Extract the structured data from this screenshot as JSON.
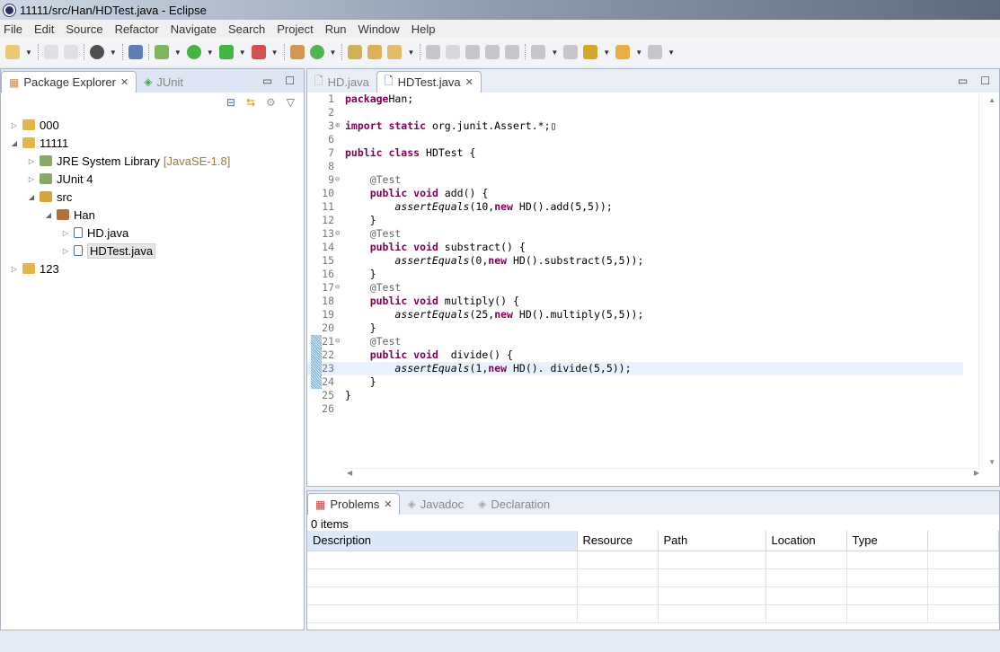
{
  "window": {
    "title": "11111/src/Han/HDTest.java - Eclipse"
  },
  "menu": [
    "File",
    "Edit",
    "Source",
    "Refactor",
    "Navigate",
    "Search",
    "Project",
    "Run",
    "Window",
    "Help"
  ],
  "left_panel": {
    "tabs": [
      {
        "label": "Package Explorer",
        "active": true
      },
      {
        "label": "JUnit",
        "active": false
      }
    ],
    "tree": [
      {
        "label": "000",
        "depth": 0,
        "twisty": "closed",
        "icon": "project-icon"
      },
      {
        "label": "11111",
        "depth": 0,
        "twisty": "open",
        "icon": "project-icon"
      },
      {
        "label": "JRE System Library",
        "decoration": "[JavaSE-1.8]",
        "depth": 1,
        "twisty": "closed",
        "icon": "library-icon"
      },
      {
        "label": "JUnit 4",
        "depth": 1,
        "twisty": "closed",
        "icon": "library-icon"
      },
      {
        "label": "src",
        "depth": 1,
        "twisty": "open",
        "icon": "source-folder-icon"
      },
      {
        "label": "Han",
        "depth": 2,
        "twisty": "open",
        "icon": "package-icon"
      },
      {
        "label": "HD.java",
        "depth": 3,
        "twisty": "closed",
        "icon": "java-file-icon"
      },
      {
        "label": "HDTest.java",
        "depth": 3,
        "twisty": "closed",
        "icon": "java-file-icon",
        "selected": true
      },
      {
        "label": "123",
        "depth": 0,
        "twisty": "closed",
        "icon": "project-icon"
      }
    ]
  },
  "editor": {
    "tabs": [
      {
        "label": "HD.java",
        "active": false
      },
      {
        "label": "HDTest.java",
        "active": true
      }
    ],
    "current_line": "23",
    "changed_lines": [
      "21",
      "22",
      "23",
      "24"
    ],
    "lines": [
      {
        "n": "1",
        "s": [
          [
            "kw",
            "package"
          ],
          [
            "",
            "Han;"
          ]
        ]
      },
      {
        "n": "2",
        "s": []
      },
      {
        "n": "3",
        "fold": "plus",
        "s": [
          [
            "kw",
            "import static"
          ],
          [
            "",
            " org.junit.Assert.*;"
          ],
          [
            "",
            "▯"
          ]
        ]
      },
      {
        "n": "6",
        "s": []
      },
      {
        "n": "7",
        "s": [
          [
            "kw",
            "public class"
          ],
          [
            "",
            " HDTest {"
          ]
        ]
      },
      {
        "n": "8",
        "s": []
      },
      {
        "n": "9",
        "fold": "minus",
        "s": [
          [
            "",
            "    "
          ],
          [
            "an",
            "@Test"
          ]
        ]
      },
      {
        "n": "10",
        "s": [
          [
            "",
            "    "
          ],
          [
            "kw",
            "public void"
          ],
          [
            "",
            " add() {"
          ]
        ]
      },
      {
        "n": "11",
        "s": [
          [
            "",
            "        "
          ],
          [
            "it",
            "assertEquals"
          ],
          [
            "",
            "(10,"
          ],
          [
            "kw",
            "new"
          ],
          [
            "",
            " HD().add(5,5));"
          ]
        ]
      },
      {
        "n": "12",
        "s": [
          [
            "",
            "    }"
          ]
        ]
      },
      {
        "n": "13",
        "fold": "minus",
        "s": [
          [
            "",
            "    "
          ],
          [
            "an",
            "@Test"
          ]
        ]
      },
      {
        "n": "14",
        "s": [
          [
            "",
            "    "
          ],
          [
            "kw",
            "public void"
          ],
          [
            "",
            " substract() {"
          ]
        ]
      },
      {
        "n": "15",
        "s": [
          [
            "",
            "        "
          ],
          [
            "it",
            "assertEquals"
          ],
          [
            "",
            "(0,"
          ],
          [
            "kw",
            "new"
          ],
          [
            "",
            " HD().substract(5,5));"
          ]
        ]
      },
      {
        "n": "16",
        "s": [
          [
            "",
            "    }"
          ]
        ]
      },
      {
        "n": "17",
        "fold": "minus",
        "s": [
          [
            "",
            "    "
          ],
          [
            "an",
            "@Test"
          ]
        ]
      },
      {
        "n": "18",
        "s": [
          [
            "",
            "    "
          ],
          [
            "kw",
            "public void"
          ],
          [
            "",
            " multiply() {"
          ]
        ]
      },
      {
        "n": "19",
        "s": [
          [
            "",
            "        "
          ],
          [
            "it",
            "assertEquals"
          ],
          [
            "",
            "(25,"
          ],
          [
            "kw",
            "new"
          ],
          [
            "",
            " HD().multiply(5,5));"
          ]
        ]
      },
      {
        "n": "20",
        "s": [
          [
            "",
            "    }"
          ]
        ]
      },
      {
        "n": "21",
        "fold": "minus",
        "s": [
          [
            "",
            "    "
          ],
          [
            "an",
            "@Test"
          ]
        ]
      },
      {
        "n": "22",
        "s": [
          [
            "",
            "    "
          ],
          [
            "kw",
            "public void"
          ],
          [
            "",
            "  divide() {"
          ]
        ]
      },
      {
        "n": "23",
        "s": [
          [
            "",
            "        "
          ],
          [
            "it",
            "assertEquals"
          ],
          [
            "",
            "(1,"
          ],
          [
            "kw",
            "new"
          ],
          [
            "",
            " HD(). divide(5,5));"
          ]
        ]
      },
      {
        "n": "24",
        "s": [
          [
            "",
            "    }"
          ]
        ]
      },
      {
        "n": "25",
        "s": [
          [
            "",
            "}"
          ]
        ]
      },
      {
        "n": "26",
        "s": []
      }
    ]
  },
  "bottom_panel": {
    "tabs": [
      {
        "label": "Problems",
        "active": true
      },
      {
        "label": "Javadoc",
        "active": false
      },
      {
        "label": "Declaration",
        "active": false
      }
    ],
    "count": "0 items",
    "columns": [
      "Description",
      "Resource",
      "Path",
      "Location",
      "Type"
    ]
  }
}
